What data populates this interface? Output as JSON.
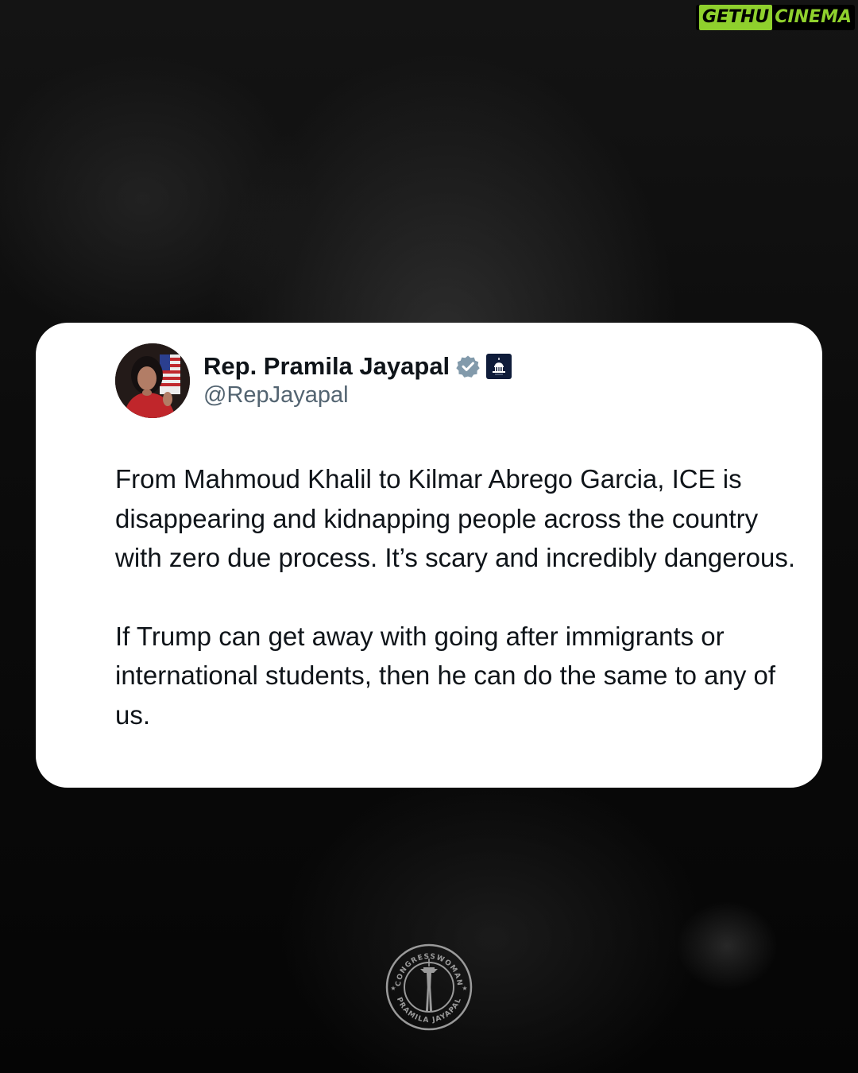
{
  "watermark": {
    "part1": "GETHU",
    "part2": "CINEMA"
  },
  "post": {
    "display_name": "Rep. Pramila Jayapal",
    "handle": "@RepJayapal",
    "paragraphs": [
      "From Mahmoud Khalil to Kilmar Abrego Garcia, ICE is disappearing and kidnapping people across the country with zero due process. It’s scary and incredibly dangerous.",
      "If Trump can get away with going after immigrants or international students, then he can do the same to any of us."
    ]
  },
  "seal": {
    "top_text": "CONGRESSWOMAN",
    "bottom_text": "PRAMILA JAYAPAL"
  },
  "icons": {
    "verified": "verified-badge-icon",
    "affiliation": "capitol-icon",
    "seal_center": "space-needle-icon"
  },
  "colors": {
    "background": "#0b0b0b",
    "card": "#ffffff",
    "text": "#0f1419",
    "handle": "#536471",
    "verified_badge": "#829aab",
    "affiliation_badge": "#0f1c3a",
    "watermark_green": "#8fd02d",
    "seal_gray": "#9a9a9a"
  }
}
